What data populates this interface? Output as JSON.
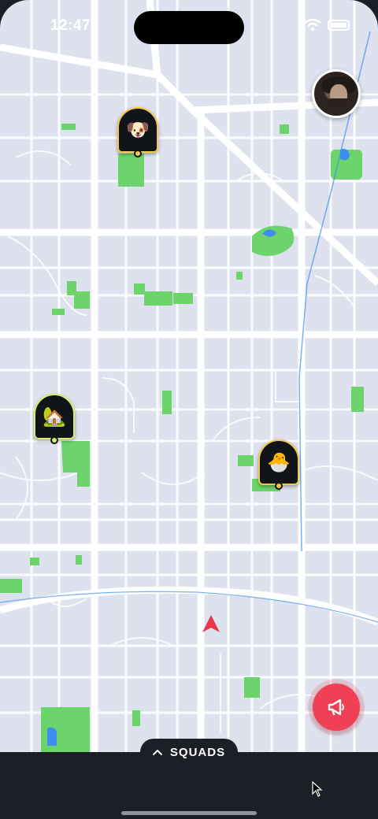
{
  "status_bar": {
    "time": "12:47"
  },
  "map": {
    "background_color": "#dde2ee",
    "road_color": "#ffffff",
    "park_color": "#6cd46a",
    "water_color": "#3d8ef0"
  },
  "user_avatar": {
    "icon": "user-avatar-photo"
  },
  "pins": [
    {
      "id": "dog",
      "emoji": "🐶",
      "accent": "#f2c94c"
    },
    {
      "id": "home",
      "emoji": "🏡",
      "accent": "#d9ef6a"
    },
    {
      "id": "chick",
      "emoji": "🐣",
      "accent": "#f2c94c"
    }
  ],
  "navigation_arrow": {
    "color": "#e8374b"
  },
  "fab": {
    "icon": "megaphone-icon",
    "color": "#ef4056"
  },
  "bottom_bar": {
    "squads_label": "SQUADS",
    "chevron": "chevron-up-icon"
  }
}
